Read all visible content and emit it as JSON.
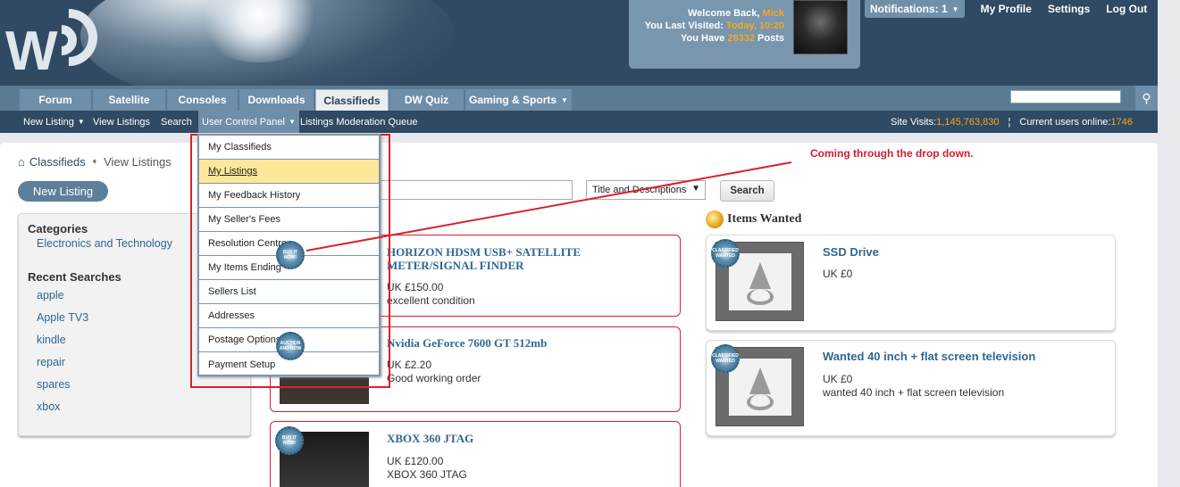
{
  "header": {
    "logo_text": "W",
    "welcome": {
      "line1_prefix": "Welcome Back, ",
      "username": "Mick",
      "line2_prefix": "You Last Visited: ",
      "last_visited": "Today, 10:20",
      "line3_prefix": "You Have ",
      "post_count": "28332",
      "line3_suffix": " Posts"
    },
    "notifications_label": "Notifications: 1",
    "links": [
      "My Profile",
      "Settings",
      "Log Out"
    ]
  },
  "nav": {
    "tabs": [
      "Forum",
      "Satellite",
      "Consoles",
      "Downloads",
      "Classifieds",
      "DW Quiz",
      "Gaming & Sports"
    ],
    "active_tab": "Classifieds"
  },
  "subnav": {
    "items": [
      "New Listing",
      "View Listings",
      "Search",
      "User Control Panel",
      "Listings Moderation Queue"
    ],
    "site_visits_label": "Site Visits: ",
    "site_visits": "1,145,763,830",
    "separator": "¦",
    "online_label": "Current users online: ",
    "online": "1746"
  },
  "breadcrumb": [
    "Classifieds",
    "View Listings"
  ],
  "new_listing_button": "New Listing",
  "sidebar": {
    "categories_title": "Categories",
    "categories": [
      "Electronics and Technology"
    ],
    "recent_title": "Recent Searches",
    "recent": [
      "apple",
      "Apple TV3",
      "kindle",
      "repair",
      "spares",
      "xbox"
    ]
  },
  "search": {
    "select_value": "Title and Descriptions",
    "button": "Search"
  },
  "annotation": "Coming through the drop down.",
  "dropdown": {
    "items": [
      "My Classifieds",
      "My Listings",
      "My Feedback History",
      "My Seller's Fees",
      "Resolution Centre",
      "My Items Ending",
      "Sellers List",
      "Addresses",
      "Postage Options",
      "Payment Setup"
    ],
    "highlighted": "My Listings"
  },
  "listings": [
    {
      "title": "HORIZON HDSM USB+ SATELLITE METER/SIGNAL FINDER",
      "price": "UK £150.00",
      "desc": "excellent condition"
    },
    {
      "title": "Nvidia GeForce 7600 GT 512mb",
      "price": "UK £2.20",
      "desc": "Good working order"
    },
    {
      "title": "XBOX 360 JTAG",
      "price": "UK £120.00",
      "desc": "XBOX 360 JTAG"
    }
  ],
  "wanted": {
    "title": "Items Wanted",
    "items": [
      {
        "title": "SSD Drive",
        "price": "UK £0",
        "desc": ""
      },
      {
        "title": "Wanted 40 inch + flat screen television",
        "price": "UK £0",
        "desc": "wanted 40 inch + flat screen television"
      }
    ]
  },
  "badges": {
    "buy": "BUY IT NOW!",
    "auction": "AUCTION AND NOW",
    "wanted": "CLASSIFIED WANTED"
  }
}
